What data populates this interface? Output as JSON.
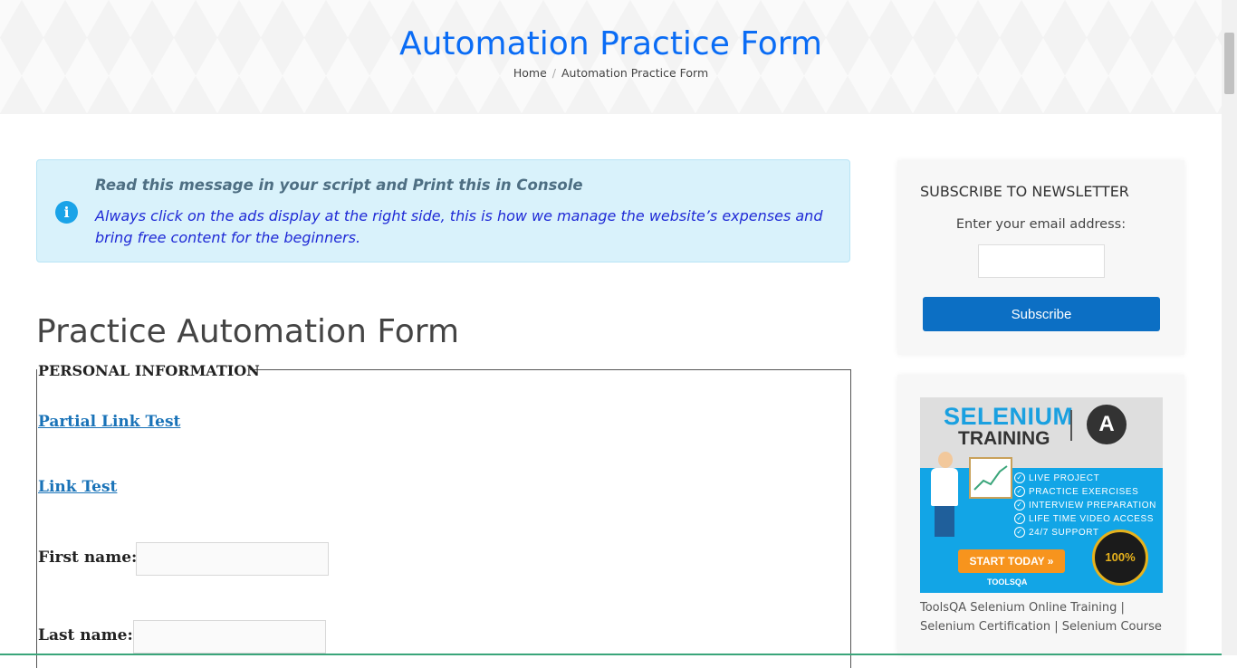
{
  "header": {
    "title": "Automation Practice Form",
    "breadcrumb": {
      "home": "Home",
      "separator": "/",
      "current": "Automation Practice Form"
    }
  },
  "alert": {
    "icon": "info-icon",
    "title": "Read this message in your script and Print this in Console",
    "body": "Always click on the ads display at the right side, this is how we manage the website’s expenses and bring free content for the beginners."
  },
  "form": {
    "heading": "Practice Automation Form",
    "legend": "PERSONAL INFORMATION",
    "partial_link": "Partial Link Test",
    "link": "Link Test",
    "first_name_label": "First name:",
    "first_name_value": "",
    "last_name_label": "Last name:",
    "last_name_value": ""
  },
  "newsletter": {
    "title": "SUBSCRIBE TO NEWSLETTER",
    "label": "Enter your email address:",
    "email_value": "",
    "button": "Subscribe",
    "button_color": "#0c6fc4"
  },
  "ad": {
    "brand": "SELENIUM",
    "subtitle": "TRAINING",
    "logo_letter": "A",
    "items": [
      "LIVE PROJECT",
      "PRACTICE EXERCISES",
      "INTERVIEW PREPARATION",
      "LIFE TIME VIDEO ACCESS",
      "24/7 SUPPORT"
    ],
    "cta": "START TODAY »",
    "footer_brand": "TOOLSQA",
    "badge": "100%",
    "caption": "ToolsQA Selenium Online Training | Selenium Certification | Selenium Course"
  },
  "colors": {
    "title_blue": "#0a6cf5",
    "link_blue": "#1a73b8",
    "alert_bg": "#d9f2fb"
  }
}
